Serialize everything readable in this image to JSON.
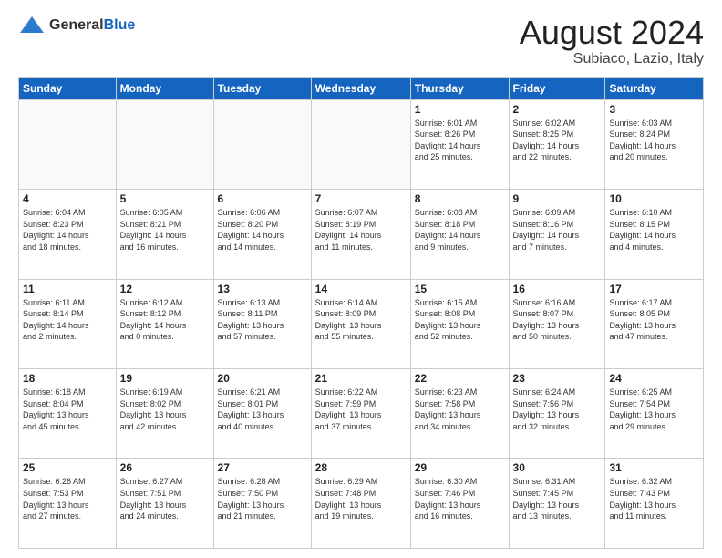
{
  "header": {
    "logo_general": "General",
    "logo_blue": "Blue",
    "title": "August 2024",
    "subtitle": "Subiaco, Lazio, Italy"
  },
  "days_of_week": [
    "Sunday",
    "Monday",
    "Tuesday",
    "Wednesday",
    "Thursday",
    "Friday",
    "Saturday"
  ],
  "weeks": [
    [
      {
        "day": "",
        "info": ""
      },
      {
        "day": "",
        "info": ""
      },
      {
        "day": "",
        "info": ""
      },
      {
        "day": "",
        "info": ""
      },
      {
        "day": "1",
        "info": "Sunrise: 6:01 AM\nSunset: 8:26 PM\nDaylight: 14 hours\nand 25 minutes."
      },
      {
        "day": "2",
        "info": "Sunrise: 6:02 AM\nSunset: 8:25 PM\nDaylight: 14 hours\nand 22 minutes."
      },
      {
        "day": "3",
        "info": "Sunrise: 6:03 AM\nSunset: 8:24 PM\nDaylight: 14 hours\nand 20 minutes."
      }
    ],
    [
      {
        "day": "4",
        "info": "Sunrise: 6:04 AM\nSunset: 8:23 PM\nDaylight: 14 hours\nand 18 minutes."
      },
      {
        "day": "5",
        "info": "Sunrise: 6:05 AM\nSunset: 8:21 PM\nDaylight: 14 hours\nand 16 minutes."
      },
      {
        "day": "6",
        "info": "Sunrise: 6:06 AM\nSunset: 8:20 PM\nDaylight: 14 hours\nand 14 minutes."
      },
      {
        "day": "7",
        "info": "Sunrise: 6:07 AM\nSunset: 8:19 PM\nDaylight: 14 hours\nand 11 minutes."
      },
      {
        "day": "8",
        "info": "Sunrise: 6:08 AM\nSunset: 8:18 PM\nDaylight: 14 hours\nand 9 minutes."
      },
      {
        "day": "9",
        "info": "Sunrise: 6:09 AM\nSunset: 8:16 PM\nDaylight: 14 hours\nand 7 minutes."
      },
      {
        "day": "10",
        "info": "Sunrise: 6:10 AM\nSunset: 8:15 PM\nDaylight: 14 hours\nand 4 minutes."
      }
    ],
    [
      {
        "day": "11",
        "info": "Sunrise: 6:11 AM\nSunset: 8:14 PM\nDaylight: 14 hours\nand 2 minutes."
      },
      {
        "day": "12",
        "info": "Sunrise: 6:12 AM\nSunset: 8:12 PM\nDaylight: 14 hours\nand 0 minutes."
      },
      {
        "day": "13",
        "info": "Sunrise: 6:13 AM\nSunset: 8:11 PM\nDaylight: 13 hours\nand 57 minutes."
      },
      {
        "day": "14",
        "info": "Sunrise: 6:14 AM\nSunset: 8:09 PM\nDaylight: 13 hours\nand 55 minutes."
      },
      {
        "day": "15",
        "info": "Sunrise: 6:15 AM\nSunset: 8:08 PM\nDaylight: 13 hours\nand 52 minutes."
      },
      {
        "day": "16",
        "info": "Sunrise: 6:16 AM\nSunset: 8:07 PM\nDaylight: 13 hours\nand 50 minutes."
      },
      {
        "day": "17",
        "info": "Sunrise: 6:17 AM\nSunset: 8:05 PM\nDaylight: 13 hours\nand 47 minutes."
      }
    ],
    [
      {
        "day": "18",
        "info": "Sunrise: 6:18 AM\nSunset: 8:04 PM\nDaylight: 13 hours\nand 45 minutes."
      },
      {
        "day": "19",
        "info": "Sunrise: 6:19 AM\nSunset: 8:02 PM\nDaylight: 13 hours\nand 42 minutes."
      },
      {
        "day": "20",
        "info": "Sunrise: 6:21 AM\nSunset: 8:01 PM\nDaylight: 13 hours\nand 40 minutes."
      },
      {
        "day": "21",
        "info": "Sunrise: 6:22 AM\nSunset: 7:59 PM\nDaylight: 13 hours\nand 37 minutes."
      },
      {
        "day": "22",
        "info": "Sunrise: 6:23 AM\nSunset: 7:58 PM\nDaylight: 13 hours\nand 34 minutes."
      },
      {
        "day": "23",
        "info": "Sunrise: 6:24 AM\nSunset: 7:56 PM\nDaylight: 13 hours\nand 32 minutes."
      },
      {
        "day": "24",
        "info": "Sunrise: 6:25 AM\nSunset: 7:54 PM\nDaylight: 13 hours\nand 29 minutes."
      }
    ],
    [
      {
        "day": "25",
        "info": "Sunrise: 6:26 AM\nSunset: 7:53 PM\nDaylight: 13 hours\nand 27 minutes."
      },
      {
        "day": "26",
        "info": "Sunrise: 6:27 AM\nSunset: 7:51 PM\nDaylight: 13 hours\nand 24 minutes."
      },
      {
        "day": "27",
        "info": "Sunrise: 6:28 AM\nSunset: 7:50 PM\nDaylight: 13 hours\nand 21 minutes."
      },
      {
        "day": "28",
        "info": "Sunrise: 6:29 AM\nSunset: 7:48 PM\nDaylight: 13 hours\nand 19 minutes."
      },
      {
        "day": "29",
        "info": "Sunrise: 6:30 AM\nSunset: 7:46 PM\nDaylight: 13 hours\nand 16 minutes."
      },
      {
        "day": "30",
        "info": "Sunrise: 6:31 AM\nSunset: 7:45 PM\nDaylight: 13 hours\nand 13 minutes."
      },
      {
        "day": "31",
        "info": "Sunrise: 6:32 AM\nSunset: 7:43 PM\nDaylight: 13 hours\nand 11 minutes."
      }
    ]
  ]
}
